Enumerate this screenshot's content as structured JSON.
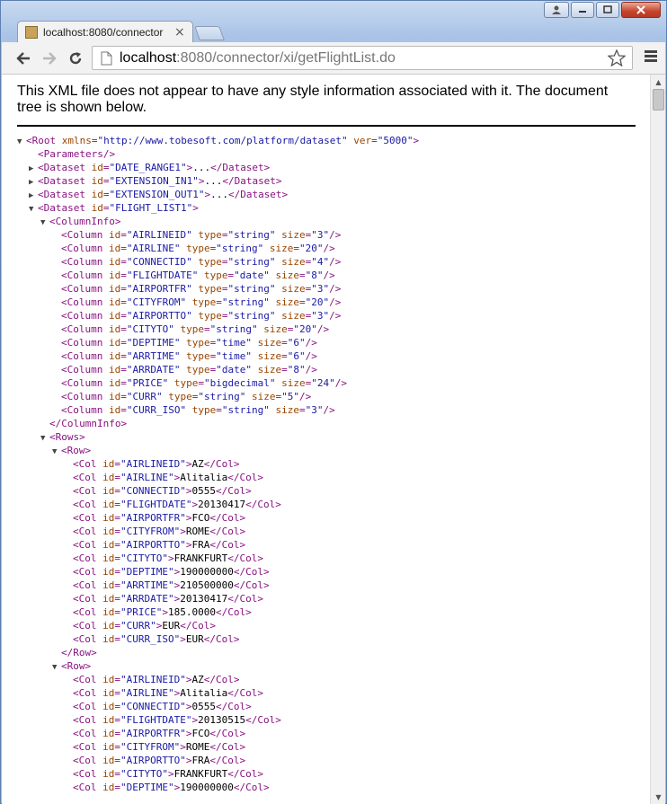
{
  "window": {
    "controls": [
      "user-icon",
      "minimize-icon",
      "maximize-icon",
      "close-icon"
    ]
  },
  "tab": {
    "title": "localhost:8080/connector",
    "close_glyph": "×"
  },
  "address": {
    "host": "localhost",
    "rest": ":8080/connector/xi/getFlightList.do"
  },
  "info": {
    "message": "This XML file does not appear to have any style information associated with it. The document tree is shown below."
  },
  "colors": {
    "tag": "#881280",
    "attr_name": "#994500",
    "attr_value": "#1a1aa6"
  },
  "xml": {
    "root_open": "<Root",
    "root_attrs": [
      {
        "name": "xmlns",
        "value": "\"http://www.tobesoft.com/platform/dataset\""
      },
      {
        "name": "ver",
        "value": "\"5000\""
      }
    ],
    "parameters": "<Parameters/>",
    "collapsed_datasets": [
      "DATE_RANGE1",
      "EXTENSION_IN1",
      "EXTENSION_OUT1"
    ],
    "flight_dataset_id": "FLIGHT_LIST1",
    "columninfo_open": "<ColumnInfo>",
    "columninfo_close": "</ColumnInfo>",
    "columns": [
      {
        "id": "AIRLINEID",
        "type": "string",
        "size": "3"
      },
      {
        "id": "AIRLINE",
        "type": "string",
        "size": "20"
      },
      {
        "id": "CONNECTID",
        "type": "string",
        "size": "4"
      },
      {
        "id": "FLIGHTDATE",
        "type": "date",
        "size": "8"
      },
      {
        "id": "AIRPORTFR",
        "type": "string",
        "size": "3"
      },
      {
        "id": "CITYFROM",
        "type": "string",
        "size": "20"
      },
      {
        "id": "AIRPORTTO",
        "type": "string",
        "size": "3"
      },
      {
        "id": "CITYTO",
        "type": "string",
        "size": "20"
      },
      {
        "id": "DEPTIME",
        "type": "time",
        "size": "6"
      },
      {
        "id": "ARRTIME",
        "type": "time",
        "size": "6"
      },
      {
        "id": "ARRDATE",
        "type": "date",
        "size": "8"
      },
      {
        "id": "PRICE",
        "type": "bigdecimal",
        "size": "24"
      },
      {
        "id": "CURR",
        "type": "string",
        "size": "5"
      },
      {
        "id": "CURR_ISO",
        "type": "string",
        "size": "3"
      }
    ],
    "rows_open": "<Rows>",
    "row_open": "<Row>",
    "row_close": "</Row>",
    "rows": [
      [
        {
          "id": "AIRLINEID",
          "value": "AZ"
        },
        {
          "id": "AIRLINE",
          "value": "Alitalia"
        },
        {
          "id": "CONNECTID",
          "value": "0555"
        },
        {
          "id": "FLIGHTDATE",
          "value": "20130417"
        },
        {
          "id": "AIRPORTFR",
          "value": "FCO"
        },
        {
          "id": "CITYFROM",
          "value": "ROME"
        },
        {
          "id": "AIRPORTTO",
          "value": "FRA"
        },
        {
          "id": "CITYTO",
          "value": "FRANKFURT"
        },
        {
          "id": "DEPTIME",
          "value": "190000000"
        },
        {
          "id": "ARRTIME",
          "value": "210500000"
        },
        {
          "id": "ARRDATE",
          "value": "20130417"
        },
        {
          "id": "PRICE",
          "value": "185.0000"
        },
        {
          "id": "CURR",
          "value": "EUR"
        },
        {
          "id": "CURR_ISO",
          "value": "EUR"
        }
      ],
      [
        {
          "id": "AIRLINEID",
          "value": "AZ"
        },
        {
          "id": "AIRLINE",
          "value": "Alitalia"
        },
        {
          "id": "CONNECTID",
          "value": "0555"
        },
        {
          "id": "FLIGHTDATE",
          "value": "20130515"
        },
        {
          "id": "AIRPORTFR",
          "value": "FCO"
        },
        {
          "id": "CITYFROM",
          "value": "ROME"
        },
        {
          "id": "AIRPORTTO",
          "value": "FRA"
        },
        {
          "id": "CITYTO",
          "value": "FRANKFURT"
        },
        {
          "id": "DEPTIME",
          "value": "190000000"
        }
      ]
    ]
  }
}
